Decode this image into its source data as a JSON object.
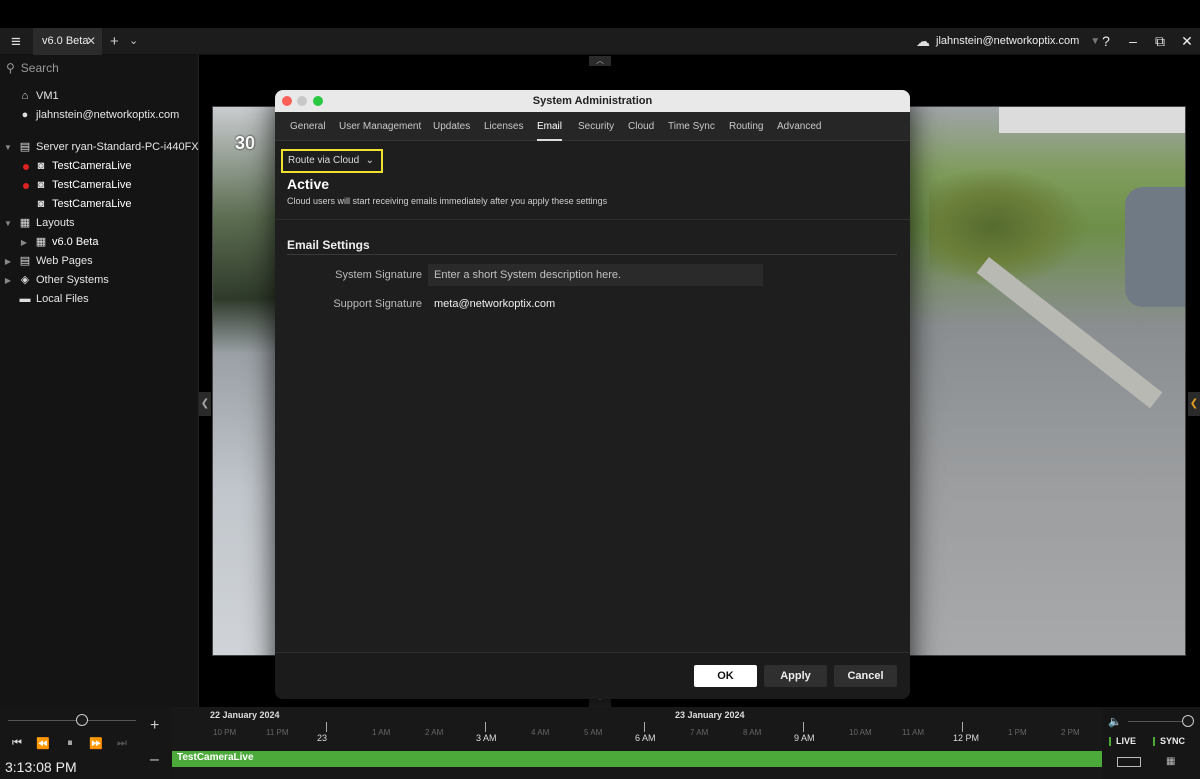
{
  "titlebar": {
    "tab_label": "v6.0 Beta",
    "account": "jlahnstein@networkoptix.com",
    "icons": [
      "menu-icon",
      "close-icon",
      "plus-icon",
      "chevron-down-icon",
      "cloud-icon",
      "help-icon",
      "minimize-icon",
      "maximize-icon",
      "close-window-icon"
    ]
  },
  "window_buttons": {
    "help": "?",
    "minimize": "–",
    "maximize": "⧉",
    "close": "✕"
  },
  "sidebar": {
    "search_placeholder": "Search",
    "items": [
      {
        "label": "VM1",
        "icon": "home-icon",
        "level": 0
      },
      {
        "label": "jlahnstein@networkoptix.com",
        "icon": "user-icon",
        "level": 0
      },
      {
        "label": "Server ryan-Standard-PC-i440FX-...",
        "icon": "server-icon",
        "level": 0,
        "expanded": true
      },
      {
        "label": "TestCameraLive",
        "icon": "camera-icon",
        "level": 1,
        "recording": true
      },
      {
        "label": "TestCameraLive",
        "icon": "camera-icon",
        "level": 1,
        "recording": true
      },
      {
        "label": "TestCameraLive",
        "icon": "camera-icon",
        "level": 1,
        "recording": false
      },
      {
        "label": "Layouts",
        "icon": "layouts-icon",
        "level": 0,
        "expanded": true
      },
      {
        "label": "v6.0 Beta",
        "icon": "layout-icon",
        "level": 1
      },
      {
        "label": "Web Pages",
        "icon": "web-pages-icon",
        "level": 0
      },
      {
        "label": "Other Systems",
        "icon": "other-systems-icon",
        "level": 0
      },
      {
        "label": "Local Files",
        "icon": "folder-icon",
        "level": 0
      }
    ]
  },
  "camera_left": {
    "timestamp": "30"
  },
  "dialog": {
    "title": "System Administration",
    "tabs": [
      "General",
      "User Management",
      "Updates",
      "Licenses",
      "Email",
      "Security",
      "Cloud",
      "Time Sync",
      "Routing",
      "Advanced"
    ],
    "active_tab": "Email",
    "route_select": "Route via Cloud",
    "status_title": "Active",
    "status_desc": "Cloud users will start receiving emails immediately after you apply these settings",
    "section_title": "Email Settings",
    "fields": [
      {
        "label": "System Signature",
        "placeholder": "Enter a short System description here.",
        "value": ""
      },
      {
        "label": "Support Signature",
        "placeholder": "",
        "value": "meta@networkoptix.com"
      }
    ],
    "buttons": {
      "ok": "OK",
      "apply": "Apply",
      "cancel": "Cancel"
    }
  },
  "timeline": {
    "clock": "3:13:08 PM",
    "zoom_in": "+",
    "zoom_out": "–",
    "dates": [
      "22 January 2024",
      "23 January 2024"
    ],
    "hours": [
      {
        "label": "10 PM",
        "major": false
      },
      {
        "label": "11 PM",
        "major": false
      },
      {
        "label": "23",
        "major": true
      },
      {
        "label": "1 AM",
        "major": false
      },
      {
        "label": "2 AM",
        "major": false
      },
      {
        "label": "3 AM",
        "major": true
      },
      {
        "label": "4 AM",
        "major": false
      },
      {
        "label": "5 AM",
        "major": false
      },
      {
        "label": "6 AM",
        "major": true
      },
      {
        "label": "7 AM",
        "major": false
      },
      {
        "label": "8 AM",
        "major": false
      },
      {
        "label": "9 AM",
        "major": true
      },
      {
        "label": "10 AM",
        "major": false
      },
      {
        "label": "11 AM",
        "major": false
      },
      {
        "label": "12 PM",
        "major": true
      },
      {
        "label": "1 PM",
        "major": false
      },
      {
        "label": "2 PM",
        "major": false
      }
    ],
    "track_label": "TestCameraLive",
    "live_label": "LIVE",
    "sync_label": "SYNC",
    "track_color": "#4caa3a"
  },
  "colors": {
    "highlight": "#f0e130",
    "recording": "#dd2222",
    "accent": "#4caa3a"
  }
}
